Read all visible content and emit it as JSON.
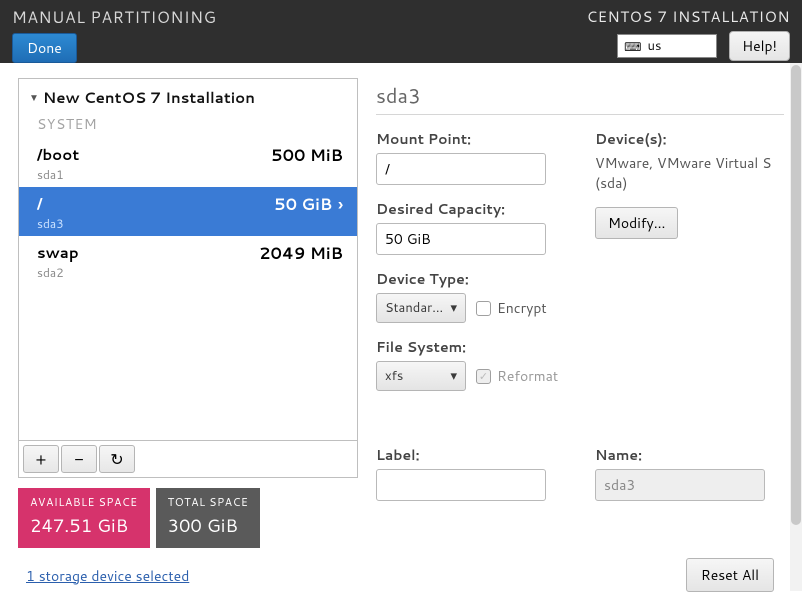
{
  "header": {
    "title": "MANUAL PARTITIONING",
    "subtitle": "CENTOS 7 INSTALLATION",
    "done_label": "Done",
    "keyboard_layout": "us",
    "help_label": "Help!"
  },
  "sidebar": {
    "install_title": "New CentOS 7 Installation",
    "section_label": "SYSTEM",
    "partitions": [
      {
        "mount": "/boot",
        "device": "sda1",
        "size": "500 MiB",
        "selected": false
      },
      {
        "mount": "/",
        "device": "sda3",
        "size": "50 GiB",
        "selected": true
      },
      {
        "mount": "swap",
        "device": "sda2",
        "size": "2049 MiB",
        "selected": false
      }
    ],
    "toolbar": {
      "add": "+",
      "remove": "−",
      "refresh": "↻"
    }
  },
  "space": {
    "available_label": "AVAILABLE SPACE",
    "available_value": "247.51 GiB",
    "total_label": "TOTAL SPACE",
    "total_value": "300 GiB"
  },
  "storage_link": "1 storage device selected",
  "detail": {
    "heading": "sda3",
    "mount_point_label": "Mount Point:",
    "mount_point_value": "/",
    "desired_capacity_label": "Desired Capacity:",
    "desired_capacity_value": "50 GiB",
    "device_type_label": "Device Type:",
    "device_type_value": "Standar...",
    "encrypt_label": "Encrypt",
    "file_system_label": "File System:",
    "file_system_value": "xfs",
    "reformat_label": "Reformat",
    "devices_label": "Device(s):",
    "devices_value": "VMware, VMware Virtual S (sda)",
    "modify_label": "Modify...",
    "label_label": "Label:",
    "label_value": "",
    "name_label": "Name:",
    "name_value": "sda3"
  },
  "reset_label": "Reset All"
}
